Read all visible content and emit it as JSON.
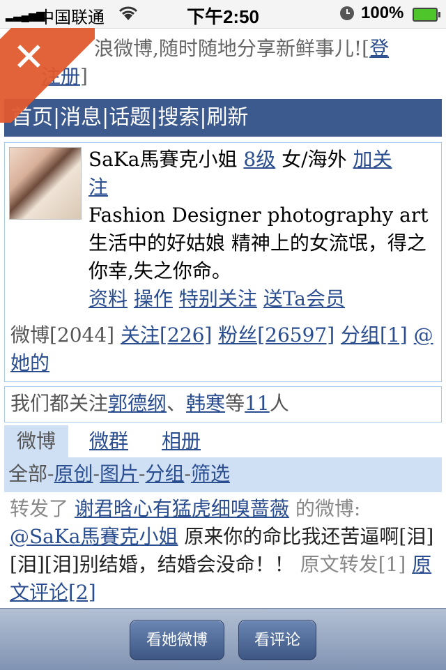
{
  "status_bar": {
    "signal": "▂▃▄▅▆",
    "carrier": "中国联通",
    "wifi": "wifi-icon",
    "time": "下午2:50",
    "clock": "clock-icon",
    "battery_pct": "100%"
  },
  "close_button": {
    "label": "✕"
  },
  "intro": {
    "text": "浪微博,随时随地分享新鲜事儿!",
    "bracket_open": "[",
    "link": "登录|注册",
    "link_visible": "登",
    "link_visible_2": "注册",
    "bracket_close": "]"
  },
  "nav": {
    "items": [
      "首页",
      "消息",
      "话题",
      "搜索",
      "刷新"
    ],
    "sep": "|"
  },
  "profile": {
    "name": "SaKa馬賽克小姐",
    "level": "8级",
    "gender_location": "女/海外",
    "follow": "加关注",
    "follow_1": "加关",
    "follow_2": "注",
    "bio": "Fashion Designer photography art 生活中的好姑娘 精神上的女流氓，得之你幸,失之你命。",
    "actions": [
      "资料",
      "操作",
      "特别关注",
      "送Ta会员"
    ],
    "weibo_count": "微博[2044]",
    "following": "关注[226]",
    "fans": "粉丝[26597]",
    "groups": "分组[1]",
    "at_her_1": "@",
    "at_her_2": "她的"
  },
  "common_follow": {
    "prefix": "我们都关注",
    "user1": "郭德纲",
    "sep": "、",
    "user2": "韩寒",
    "mid": "等",
    "count": "11",
    "suffix": "人"
  },
  "tabs": [
    "微博",
    "微群",
    "相册"
  ],
  "filter": {
    "all": "全部",
    "dash": "-",
    "original": "原创",
    "pictures": "图片",
    "group": "分组",
    "screen": "筛选"
  },
  "post": {
    "prefix": "转发了 ",
    "orig_user": "谢君晗心有猛虎细嗅蔷薇",
    "suffix": " 的微博:",
    "mention": "@SaKa馬賽克小姐",
    "text": " 原来你的命比我还苦逼啊[泪][泪][泪]别结婚，结婚会没命！！ ",
    "repost_label": "原文转发[1]",
    "comment_link": "原文评论[2]"
  },
  "toolbar": {
    "view_weibo": "看她微博",
    "view_comments": "看评论"
  }
}
